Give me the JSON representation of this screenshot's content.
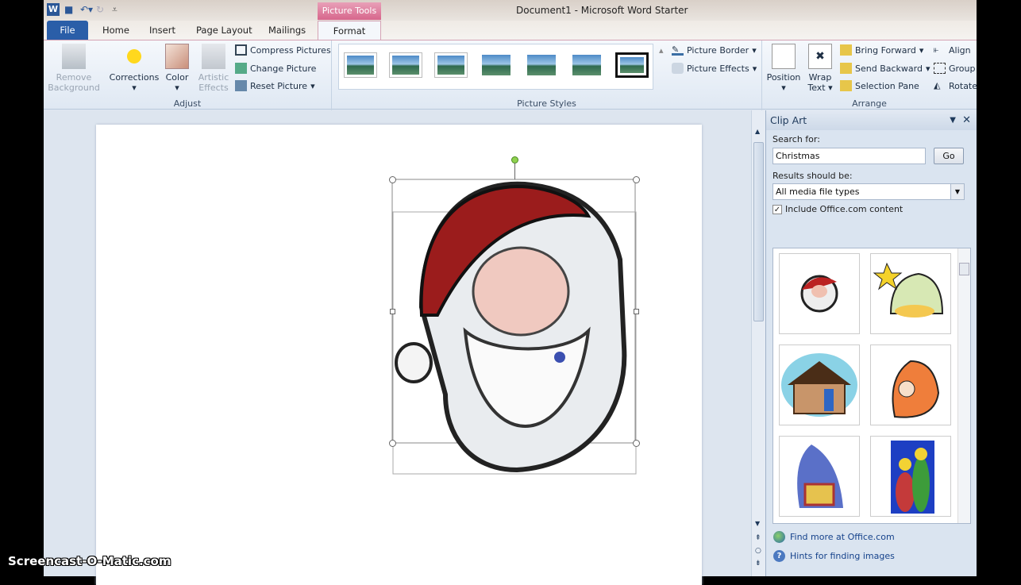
{
  "window": {
    "title": "Document1 - Microsoft Word Starter",
    "context_tab": "Picture Tools"
  },
  "tabs": [
    "File",
    "Home",
    "Insert",
    "Page Layout",
    "Mailings",
    "Format"
  ],
  "ribbon": {
    "adjust": {
      "label": "Adjust",
      "remove_background": "Remove Background",
      "corrections": "Corrections",
      "color": "Color",
      "artistic_effects": "Artistic Effects",
      "compress": "Compress Pictures",
      "change": "Change Picture",
      "reset": "Reset Picture"
    },
    "styles": {
      "label": "Picture Styles",
      "picture_border": "Picture Border",
      "picture_effects": "Picture Effects"
    },
    "arrange": {
      "label": "Arrange",
      "position": "Position",
      "wrap_text": "Wrap Text",
      "bring_forward": "Bring Forward",
      "send_backward": "Send Backward",
      "selection_pane": "Selection Pane",
      "align": "Align",
      "group": "Group",
      "rotate": "Rotate"
    }
  },
  "clip_art": {
    "title": "Clip Art",
    "search_label": "Search for:",
    "search_value": "Christmas",
    "go": "Go",
    "results_label": "Results should be:",
    "results_value": "All media file types",
    "include_label": "Include Office.com content",
    "include_checked": true,
    "find_more": "Find more at Office.com",
    "hints": "Hints for finding images",
    "results": [
      "santa-face",
      "star-nativity",
      "nativity-stable",
      "mother-child",
      "nativity-night",
      "holy-family"
    ]
  },
  "watermark": "Screencast-O-Matic.com"
}
